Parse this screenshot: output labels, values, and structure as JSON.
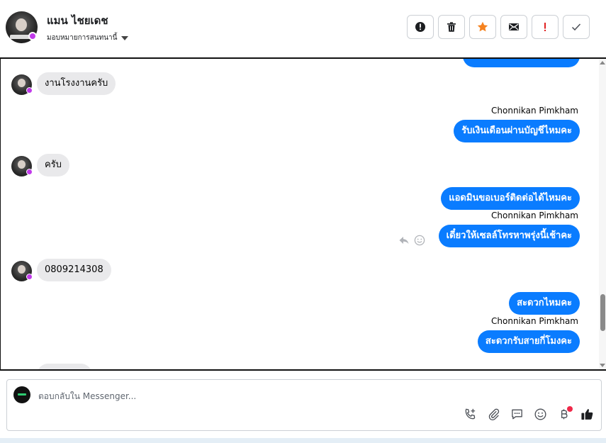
{
  "header": {
    "contact_name": "แมน ไชยเดช",
    "assign_label": "มอบหมายการสนทนานี้"
  },
  "actions": [
    {
      "name": "report-button",
      "icon": "alert-circle-icon"
    },
    {
      "name": "delete-button",
      "icon": "trash-icon"
    },
    {
      "name": "star-button",
      "icon": "star-icon"
    },
    {
      "name": "mark-unread-button",
      "icon": "envelope-icon"
    },
    {
      "name": "important-button",
      "icon": "exclamation-icon"
    },
    {
      "name": "done-button",
      "icon": "check-icon"
    }
  ],
  "colors": {
    "outgoing_bubble": "#0a7cff",
    "incoming_bubble": "#e9e9eb",
    "star": "#f5821f",
    "important": "#e02020",
    "notification_dot": "#f02849"
  },
  "messages": [
    {
      "direction": "in",
      "text": "งานโรงงานครับ"
    },
    {
      "direction": "out",
      "sender": "Chonnikan Pimkham",
      "text": "รับเงินเดือนผ่านบัญชีไหมคะ"
    },
    {
      "direction": "in",
      "text": "ครับ"
    },
    {
      "direction": "out",
      "text": "แอดมินขอเบอร์ติดต่อได้ไหมคะ"
    },
    {
      "direction": "out",
      "sender": "Chonnikan Pimkham",
      "text": "เดี๋ยวให้เซลล์โทรหาพรุ่งนี้เช้าคะ"
    },
    {
      "direction": "in",
      "text": "0809214308"
    },
    {
      "direction": "out",
      "text": "สะดวกไหมคะ"
    },
    {
      "direction": "out",
      "sender": "Chonnikan Pimkham",
      "text": "สะดวกรับสายกี่โมงคะ"
    }
  ],
  "composer": {
    "placeholder": "ตอบกลับใน Messenger...",
    "tools": [
      "phone-plus-icon",
      "paperclip-icon",
      "chat-bubble-icon",
      "smiley-icon",
      "baht-icon",
      "thumbs-up-icon"
    ]
  }
}
